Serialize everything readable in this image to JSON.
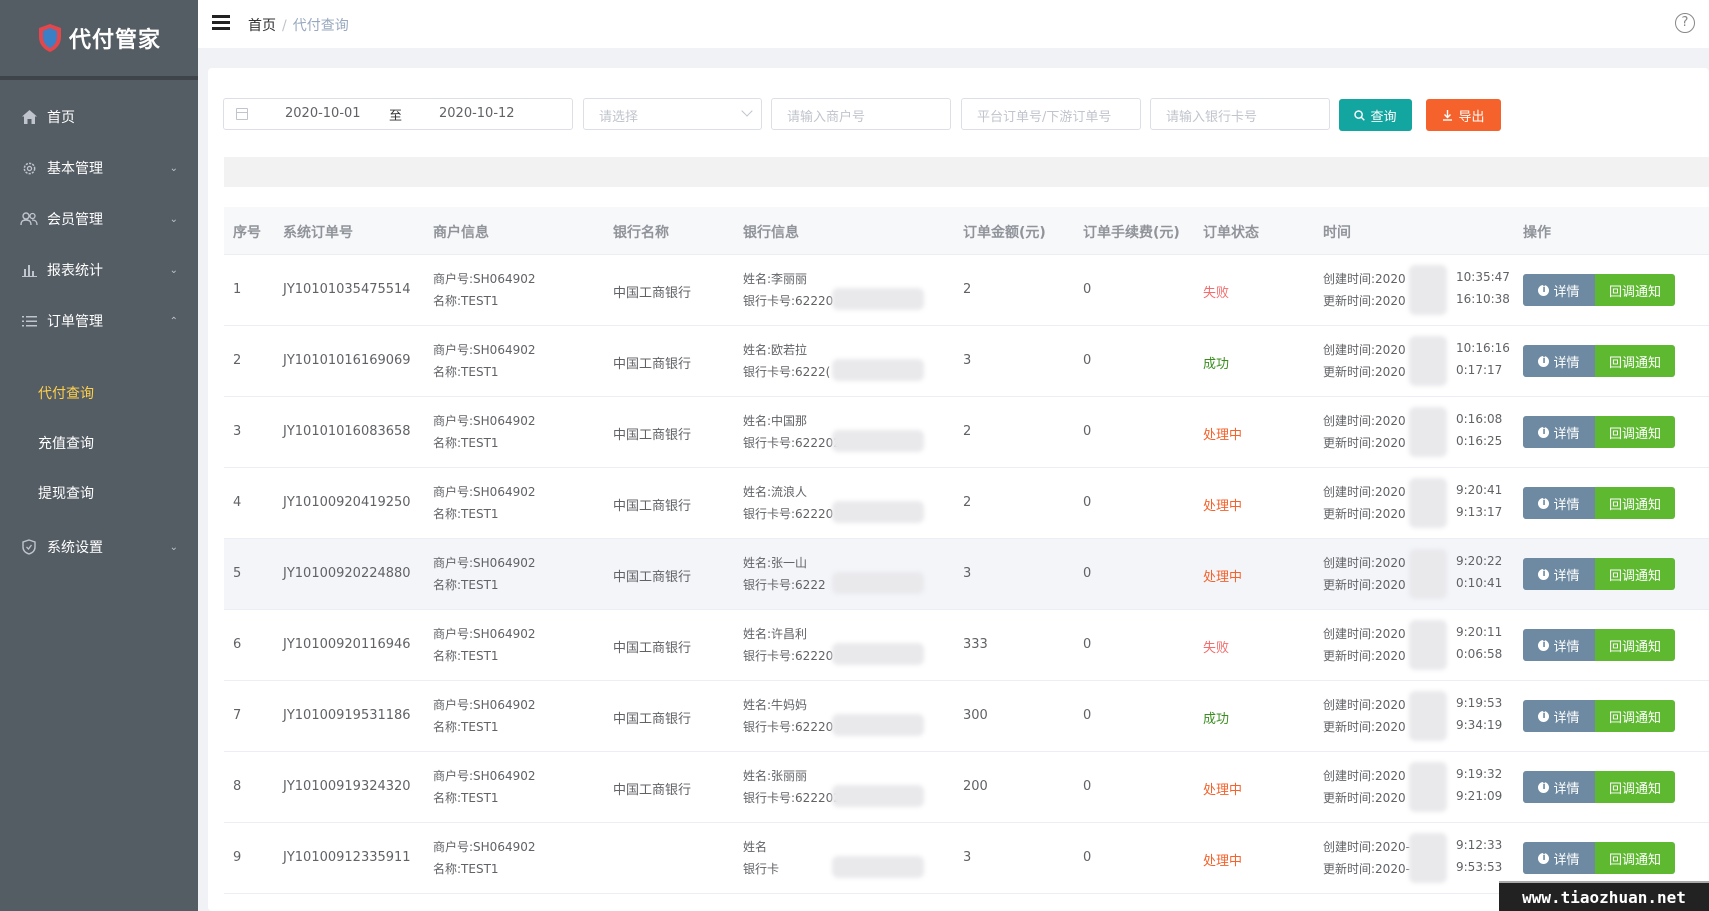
{
  "app": {
    "logo_text": "代付管家",
    "watermark": "www.tiaozhuan.net"
  },
  "sidebar": {
    "items": [
      {
        "label": "首页",
        "icon": "home-icon",
        "has_arrow": false
      },
      {
        "label": "基本管理",
        "icon": "gear-icon",
        "has_arrow": true
      },
      {
        "label": "会员管理",
        "icon": "users-icon",
        "has_arrow": true
      },
      {
        "label": "报表统计",
        "icon": "bar-chart-icon",
        "has_arrow": true
      },
      {
        "label": "订单管理",
        "icon": "list-icon",
        "has_arrow": true,
        "expanded": true
      }
    ],
    "sub_items": [
      {
        "label": "代付查询",
        "active": true
      },
      {
        "label": "充值查询",
        "active": false
      },
      {
        "label": "提现查询",
        "active": false
      }
    ],
    "settings": {
      "label": "系统设置",
      "icon": "shield-icon"
    },
    "active_color": "#ffd04b"
  },
  "header": {
    "breadcrumb_home": "首页",
    "breadcrumb_sep": "/",
    "breadcrumb_current": "代付查询",
    "help": "?"
  },
  "filters": {
    "date_start": "2020-10-01",
    "date_sep": "至",
    "date_end": "2020-10-12",
    "select_placeholder": "请选择",
    "merchant_placeholder": "请输入商户号",
    "order_placeholder": "平台订单号/下游订单号",
    "card_placeholder": "请输入银行卡号",
    "search_label": "查询",
    "export_label": "导出"
  },
  "table": {
    "columns": [
      "序号",
      "系统订单号",
      "商户信息",
      "银行名称",
      "银行信息",
      "订单金额(元)",
      "订单手续费(元)",
      "订单状态",
      "时间",
      "操作"
    ],
    "detail_label": "详情",
    "callback_label": "回调通知",
    "rows": [
      {
        "no": "1",
        "order": "JY10101035475514",
        "merchant_no": "商户号:SH064902",
        "merchant_name": "名称:TEST1",
        "bank": "中国工商银行",
        "holder": "姓名:李丽丽",
        "card": "银行卡号:62220",
        "amount": "2",
        "fee": "0",
        "status": "失败",
        "status_type": "fail",
        "created": "创建时间:2020",
        "created_tail": "10:35:47",
        "updated": "更新时间:2020",
        "updated_tail": "16:10:38"
      },
      {
        "no": "2",
        "order": "JY10101016169069",
        "merchant_no": "商户号:SH064902",
        "merchant_name": "名称:TEST1",
        "bank": "中国工商银行",
        "holder": "姓名:欧若拉",
        "card": "银行卡号:6222(",
        "amount": "3",
        "fee": "0",
        "status": "成功",
        "status_type": "success",
        "created": "创建时间:2020",
        "created_tail": "10:16:16",
        "updated": "更新时间:2020",
        "updated_tail": "0:17:17"
      },
      {
        "no": "3",
        "order": "JY10101016083658",
        "merchant_no": "商户号:SH064902",
        "merchant_name": "名称:TEST1",
        "bank": "中国工商银行",
        "holder": "姓名:中国那",
        "card": "银行卡号:622202",
        "amount": "2",
        "fee": "0",
        "status": "处理中",
        "status_type": "processing",
        "created": "创建时间:2020",
        "created_tail": "0:16:08",
        "updated": "更新时间:2020",
        "updated_tail": "0:16:25"
      },
      {
        "no": "4",
        "order": "JY10100920419250",
        "merchant_no": "商户号:SH064902",
        "merchant_name": "名称:TEST1",
        "bank": "中国工商银行",
        "holder": "姓名:流浪人",
        "card": "银行卡号:62220",
        "amount": "2",
        "fee": "0",
        "status": "处理中",
        "status_type": "processing",
        "created": "创建时间:2020",
        "created_tail": "9:20:41",
        "updated": "更新时间:2020",
        "updated_tail": "9:13:17"
      },
      {
        "no": "5",
        "order": "JY10100920224880",
        "merchant_no": "商户号:SH064902",
        "merchant_name": "名称:TEST1",
        "bank": "中国工商银行",
        "holder": "姓名:张一山",
        "card": "银行卡号:6222",
        "amount": "3",
        "fee": "0",
        "status": "处理中",
        "status_type": "processing",
        "created": "创建时间:2020",
        "created_tail": "9:20:22",
        "updated": "更新时间:2020",
        "updated_tail": "0:10:41",
        "hover": true
      },
      {
        "no": "6",
        "order": "JY10100920116946",
        "merchant_no": "商户号:SH064902",
        "merchant_name": "名称:TEST1",
        "bank": "中国工商银行",
        "holder": "姓名:许昌利",
        "card": "银行卡号:62220",
        "amount": "333",
        "fee": "0",
        "status": "失败",
        "status_type": "fail",
        "created": "创建时间:2020",
        "created_tail": "9:20:11",
        "updated": "更新时间:2020",
        "updated_tail": "0:06:58"
      },
      {
        "no": "7",
        "order": "JY10100919531186",
        "merchant_no": "商户号:SH064902",
        "merchant_name": "名称:TEST1",
        "bank": "中国工商银行",
        "holder": "姓名:牛妈妈",
        "card": "银行卡号:62220",
        "amount": "300",
        "fee": "0",
        "status": "成功",
        "status_type": "success",
        "created": "创建时间:2020",
        "created_tail": "9:19:53",
        "updated": "更新时间:2020",
        "updated_tail": "9:34:19"
      },
      {
        "no": "8",
        "order": "JY10100919324320",
        "merchant_no": "商户号:SH064902",
        "merchant_name": "名称:TEST1",
        "bank": "中国工商银行",
        "holder": "姓名:张丽丽",
        "card": "银行卡号:622202",
        "amount": "200",
        "fee": "0",
        "status": "处理中",
        "status_type": "processing",
        "created": "创建时间:2020",
        "created_tail": "9:19:32",
        "updated": "更新时间:2020",
        "updated_tail": "9:21:09"
      },
      {
        "no": "9",
        "order": "JY10100912335911",
        "merchant_no": "商户号:SH064902",
        "merchant_name": "名称:TEST1",
        "bank": "",
        "holder": "姓名",
        "card": "银行卡",
        "amount": "3",
        "fee": "0",
        "status": "处理中",
        "status_type": "processing",
        "created": "创建时间:2020-",
        "created_tail": "9:12:33",
        "updated": "更新时间:2020-",
        "updated_tail": "9:53:53"
      }
    ]
  }
}
